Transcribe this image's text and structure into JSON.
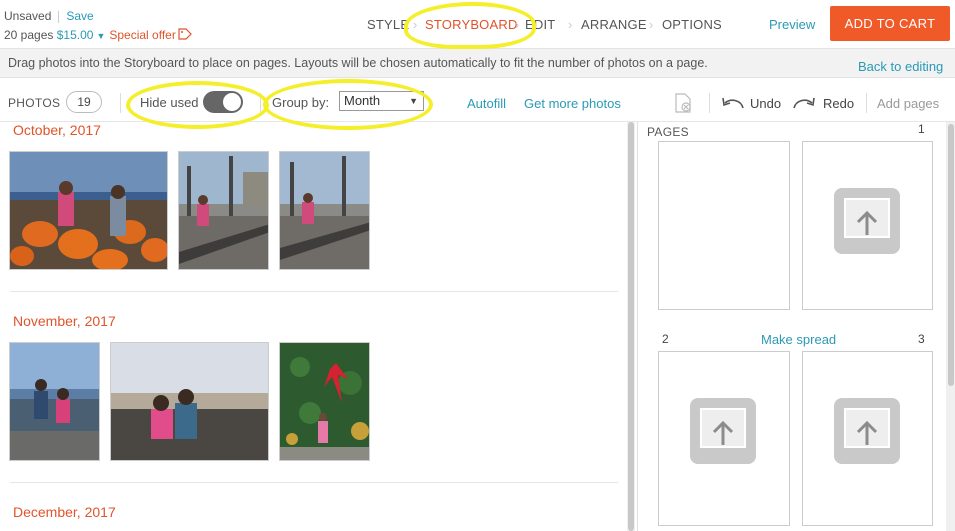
{
  "header": {
    "status": "Unsaved",
    "save_label": "Save",
    "pages_count": "20 pages",
    "price": "$15.00",
    "offer_label": "Special offer",
    "steps": [
      "STYLE",
      "STORYBOARD",
      "EDIT",
      "ARRANGE",
      "OPTIONS"
    ],
    "active_step": "STORYBOARD",
    "preview_label": "Preview",
    "cart_label": "ADD TO CART"
  },
  "hint": {
    "text": "Drag photos into the Storyboard to place on pages. Layouts will be chosen automatically to fit the number of photos on a page.",
    "back_label": "Back to editing"
  },
  "toolbar": {
    "photos_label": "PHOTOS",
    "photos_count": "19",
    "hide_used_label": "Hide used",
    "hide_used_on": true,
    "group_by_label": "Group by:",
    "group_by_value": "Month",
    "autofill_label": "Autofill",
    "get_more_label": "Get more photos",
    "undo_label": "Undo",
    "redo_label": "Redo",
    "add_pages_label": "Add pages"
  },
  "photo_groups": [
    {
      "month": "October, 2017",
      "photo_count": 3
    },
    {
      "month": "November, 2017",
      "photo_count": 3
    },
    {
      "month": "December, 2017",
      "photo_count": 0
    }
  ],
  "pages_panel": {
    "title": "PAGES",
    "page_numbers": [
      "1",
      "2",
      "3"
    ],
    "make_spread_label": "Make spread"
  },
  "colors": {
    "accent_orange": "#ef5a28",
    "link_blue": "#2a9ab5",
    "highlight_yellow": "#f5ee2a"
  }
}
